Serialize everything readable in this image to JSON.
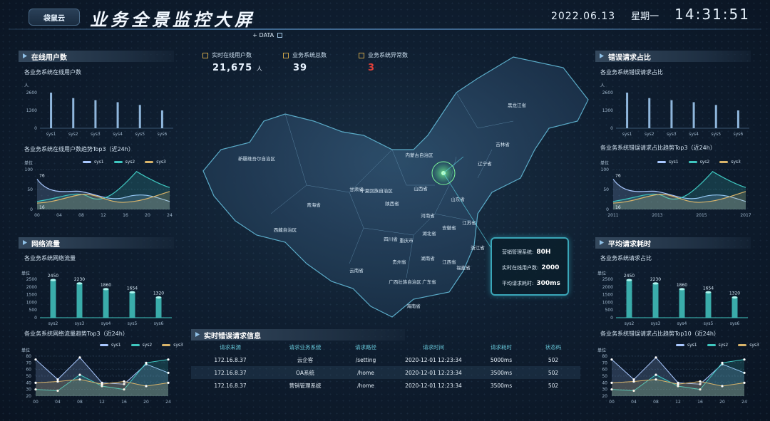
{
  "header": {
    "logo_text": "袋鼠云",
    "title": "业务全景监控大屏",
    "date": "2022.06.13",
    "weekday": "星期一",
    "time": "14:31:51",
    "data_tag": "+ DATA"
  },
  "stats": [
    {
      "label": "实时在线用户数",
      "value": "21,675",
      "unit": "人",
      "color": "#e8f3ff"
    },
    {
      "label": "业务系统总数",
      "value": "39",
      "unit": "",
      "color": "#e8f3ff"
    },
    {
      "label": "业务系统异常数",
      "value": "3",
      "unit": "",
      "color": "#e0403a"
    }
  ],
  "panels": {
    "online_users": {
      "title": "在线用户数",
      "bar_subtitle": "各业务系统在线用户数",
      "bar_unit": "人",
      "bar_yticks": [
        "2600",
        "1300",
        "0"
      ],
      "bar_categories": [
        "sys1",
        "sys2",
        "sys3",
        "sys4",
        "sys5",
        "sys6"
      ],
      "bar_values": [
        2600,
        2200,
        2050,
        1900,
        1700,
        1300
      ],
      "trend_subtitle": "各业务系统在线用户数趋势Top3（近24h）",
      "trend_unit": "单位",
      "trend_yticks": [
        "100",
        "50",
        "0"
      ],
      "trend_xticks": [
        "00",
        "04",
        "08",
        "12",
        "16",
        "20",
        "24"
      ],
      "trend_label_max": "76",
      "trend_label_min": "16"
    },
    "network": {
      "title": "网络流量",
      "bar_subtitle": "各业务系统网络流量",
      "bar_unit": "单位",
      "bar_yticks": [
        "2500",
        "2000",
        "1500",
        "1000",
        "500",
        "0"
      ],
      "bar_categories": [
        "sys2",
        "sys3",
        "sys4",
        "sys5",
        "sys6"
      ],
      "bar_values": [
        2450,
        2230,
        1860,
        1654,
        1320
      ],
      "bar_labels": [
        "2450",
        "2230",
        "1860",
        "1654",
        "1320"
      ],
      "trend_subtitle": "各业务系统网络流量趋势Top3（近24h）",
      "trend_unit": "单位",
      "trend_yticks": [
        "80",
        "70",
        "60",
        "50",
        "40",
        "30",
        "20"
      ],
      "trend_xticks": [
        "00",
        "04",
        "08",
        "12",
        "16",
        "20",
        "24"
      ]
    },
    "error_ratio": {
      "title": "错误请求占比",
      "bar_subtitle": "各业务系统错误请求占比",
      "bar_unit": "人",
      "bar_yticks": [
        "2600",
        "1300",
        "0"
      ],
      "bar_categories": [
        "sys1",
        "sys2",
        "sys3",
        "sys4",
        "sys5",
        "sys6"
      ],
      "bar_values": [
        2600,
        2200,
        2050,
        1900,
        1700,
        1300
      ],
      "trend_subtitle": "各业务系统错误请求占比趋势Top3（近24h）",
      "trend_unit": "单位",
      "trend_yticks": [
        "100",
        "50",
        "0"
      ],
      "trend_xticks": [
        "2011",
        "2013",
        "2015",
        "2017"
      ],
      "trend_label_max": "76",
      "trend_label_min": "16"
    },
    "latency": {
      "title": "平均请求耗时",
      "bar_subtitle": "各业务系统请求占比",
      "bar_unit": "单位",
      "bar_yticks": [
        "2500",
        "2000",
        "1500",
        "1000",
        "500",
        "0"
      ],
      "bar_categories": [
        "sys2",
        "sys3",
        "sys4",
        "sys5",
        "sys6"
      ],
      "bar_values": [
        2450,
        2230,
        1860,
        1654,
        1320
      ],
      "bar_labels": [
        "2450",
        "2230",
        "1860",
        "1654",
        "1320"
      ],
      "trend_subtitle": "各业务系统错误请求占比趋势Top10（近24h）",
      "trend_unit": "单位",
      "trend_yticks": [
        "80",
        "70",
        "60",
        "50",
        "40",
        "30",
        "20"
      ],
      "trend_xticks": [
        "00",
        "04",
        "08",
        "12",
        "16",
        "20",
        "24"
      ]
    }
  },
  "legend": [
    "sys1",
    "sys2",
    "sys3"
  ],
  "legend_colors": [
    "#a9c8ff",
    "#3fc7c0",
    "#d9b46a"
  ],
  "map": {
    "provinces": [
      {
        "name": "新疆维吾尔自治区"
      },
      {
        "name": "西藏自治区"
      },
      {
        "name": "青海省"
      },
      {
        "name": "甘肃省"
      },
      {
        "name": "内蒙古自治区"
      },
      {
        "name": "黑龙江省"
      },
      {
        "name": "吉林省"
      },
      {
        "name": "辽宁省"
      },
      {
        "name": "宁夏回族自治区"
      },
      {
        "name": "陕西省"
      },
      {
        "name": "山西省"
      },
      {
        "name": "山东省"
      },
      {
        "name": "河南省"
      },
      {
        "name": "四川省"
      },
      {
        "name": "重庆市"
      },
      {
        "name": "湖北省"
      },
      {
        "name": "安徽省"
      },
      {
        "name": "江苏省"
      },
      {
        "name": "浙江省"
      },
      {
        "name": "贵州省"
      },
      {
        "name": "湖南省"
      },
      {
        "name": "江西省"
      },
      {
        "name": "福建省"
      },
      {
        "name": "云南省"
      },
      {
        "name": "广西壮族自治区"
      },
      {
        "name": "广东省"
      },
      {
        "name": "海南省"
      }
    ]
  },
  "info_box": [
    {
      "label": "营销管理系统:",
      "value": "80H"
    },
    {
      "label": "实时在线用户数:",
      "value": "2000"
    },
    {
      "label": "平均请求耗时:",
      "value": "300ms"
    }
  ],
  "errors_table": {
    "title": "实时错误请求信息",
    "columns": [
      "请求来源",
      "请求业务系统",
      "请求路径",
      "请求时间",
      "请求耗时",
      "状态码"
    ],
    "rows": [
      [
        "172.16.8.37",
        "云企客",
        "/setting",
        "2020-12-01 12:23:34",
        "5000ms",
        "502"
      ],
      [
        "172.16.8.37",
        "OA系统",
        "/home",
        "2020-12-01 12:23:34",
        "3500ms",
        "502"
      ],
      [
        "172.16.8.37",
        "营销管理系统",
        "/home",
        "2020-12-01 12:23:34",
        "3500ms",
        "502"
      ]
    ]
  }
}
